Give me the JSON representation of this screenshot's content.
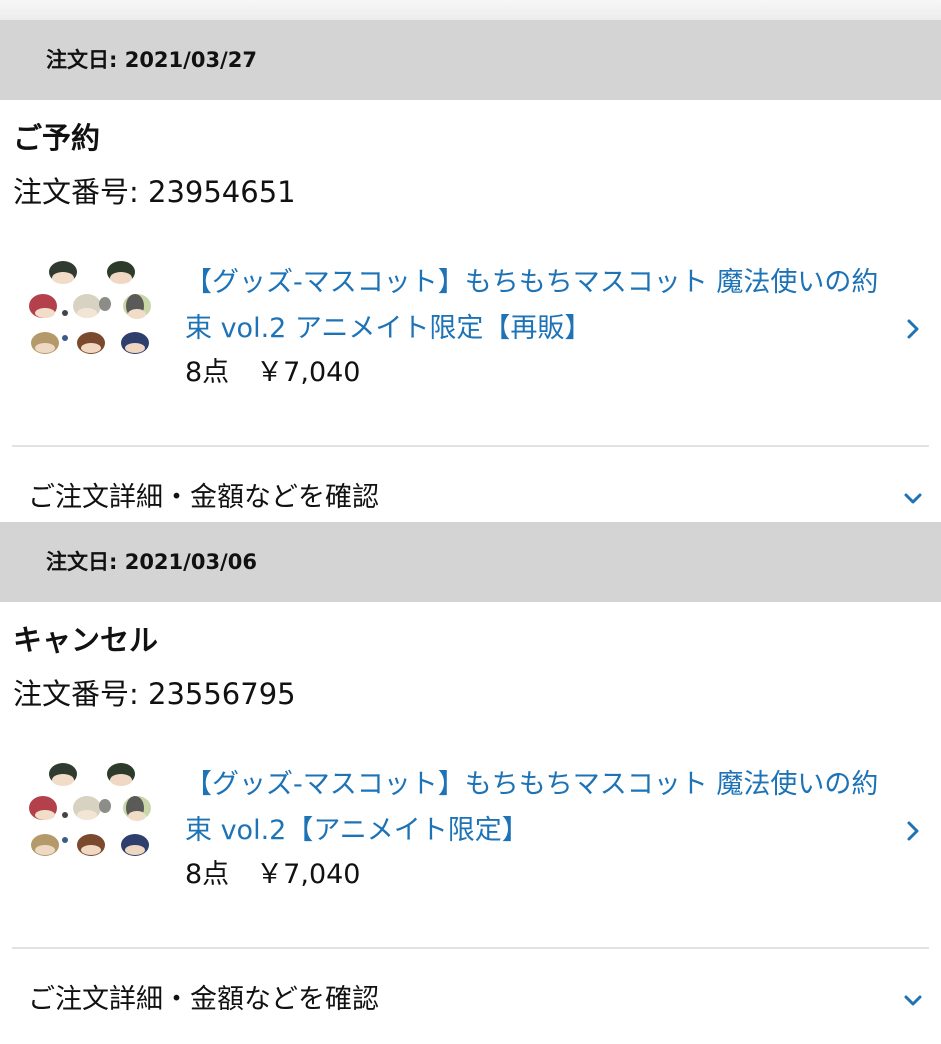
{
  "orders": [
    {
      "date": "注文日: 2021/03/27",
      "status": "ご予約",
      "order_number": "注文番号: 23954651",
      "product": {
        "title": "【グッズ-マスコット】もちもちマスコット 魔法使いの約束 vol.2 アニメイト限定【再販】",
        "quantity_price": "8点　￥7,040"
      },
      "details_label": "ご注文詳細・金額などを確認"
    },
    {
      "date": "注文日: 2021/03/06",
      "status": "キャンセル",
      "order_number": "注文番号: 23556795",
      "product": {
        "title": "【グッズ-マスコット】もちもちマスコット 魔法使いの約束 vol.2【アニメイト限定】",
        "quantity_price": "8点　￥7,040"
      },
      "details_label": "ご注文詳細・金額などを確認"
    }
  ],
  "colors": {
    "link": "#1d73b6",
    "date_bar": "#d4d4d4",
    "divider": "#e2e2e2"
  },
  "icons": {
    "product_link": "chevron-right-icon",
    "details_toggle": "chevron-down-icon",
    "thumbnail": "mascot-thumbnail"
  }
}
